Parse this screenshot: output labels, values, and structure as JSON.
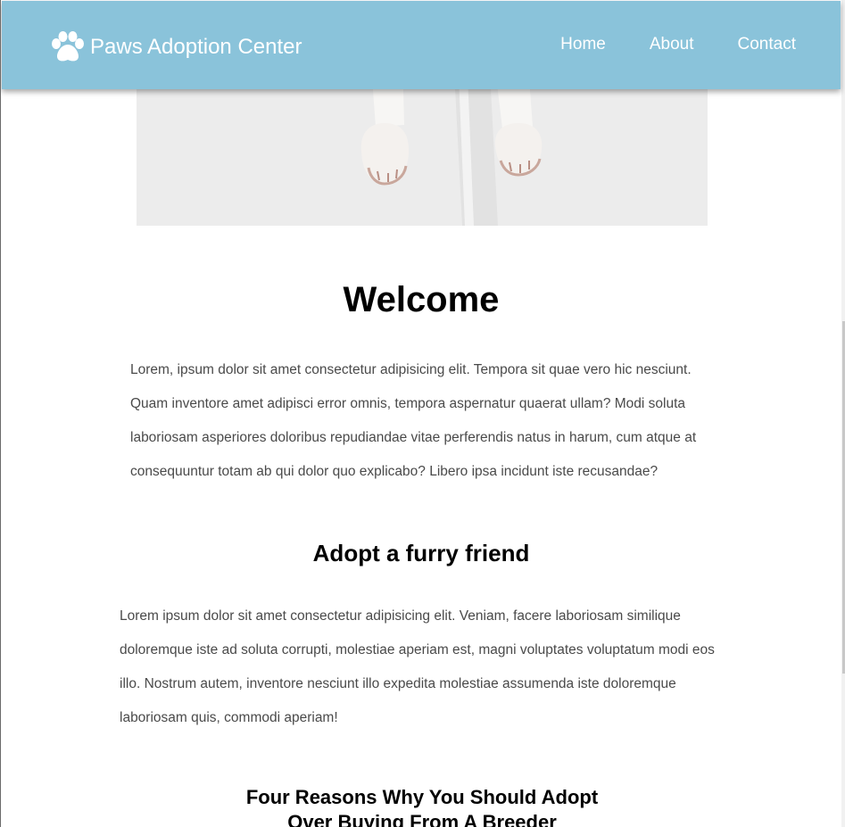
{
  "navbar": {
    "brand_name": "Paws Adoption Center",
    "brand_icon": "paw-icon",
    "links": [
      {
        "label": "Home"
      },
      {
        "label": "About"
      },
      {
        "label": "Contact"
      }
    ],
    "background_color": "#8ac3da"
  },
  "hero": {
    "image": "dog-paws-photo"
  },
  "welcome": {
    "heading": "Welcome",
    "text": "Lorem, ipsum dolor sit amet consectetur adipisicing elit. Tempora sit quae vero hic nesciunt. Quam inventore amet adipisci error omnis, tempora aspernatur quaerat ullam? Modi soluta laboriosam asperiores doloribus repudiandae vitae perferendis natus in harum, cum atque at consequuntur totam ab qui dolor quo explicabo? Libero ipsa incidunt iste recusandae?"
  },
  "adopt": {
    "heading": "Adopt a furry friend",
    "text": "Lorem ipsum dolor sit amet consectetur adipisicing elit. Veniam, facere laboriosam similique doloremque iste ad soluta corrupti, molestiae aperiam est, magni voluptates voluptatum modi eos illo. Nostrum autem, inventore nesciunt illo expedita molestiae assumenda iste doloremque laboriosam quis, commodi aperiam!"
  },
  "reasons": {
    "heading": "Four Reasons Why You Should Adopt Over Buying From A Breeder"
  }
}
